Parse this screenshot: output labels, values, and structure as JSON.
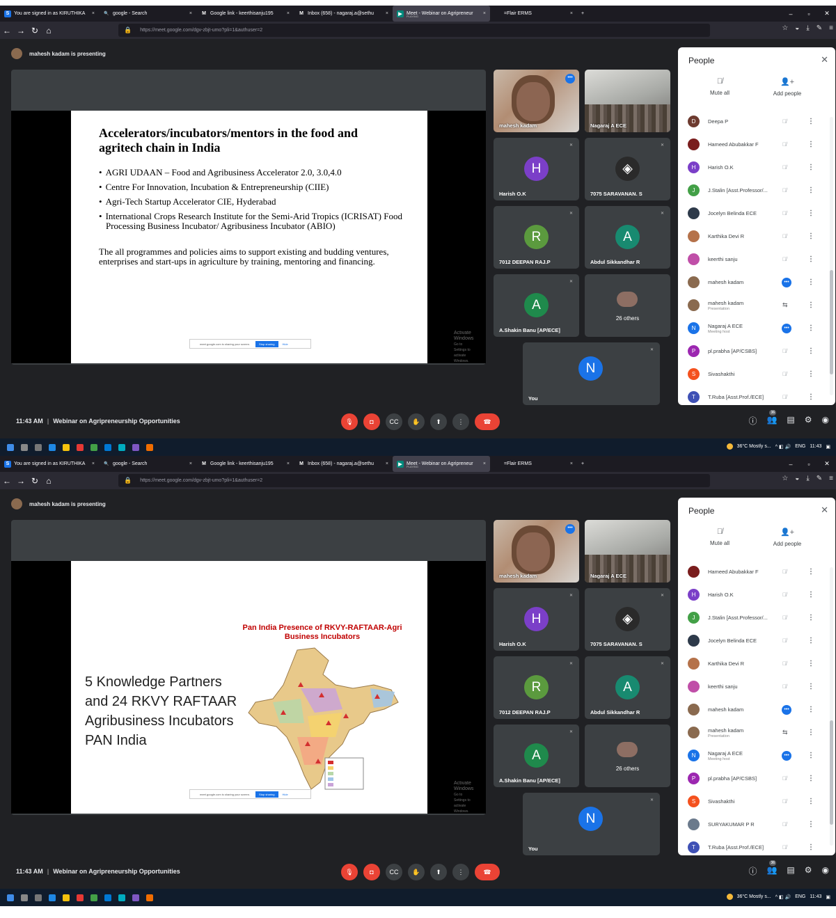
{
  "screens": [
    {
      "tabs": [
        {
          "label": "You are signed in as KIRUTHIKA",
          "icon": "S",
          "icon_color": "#1a73e8",
          "width": 142,
          "close": "×"
        },
        {
          "label": "google - Search",
          "icon": "search-icon",
          "icon_color": "#1c1b22",
          "width": 140,
          "close": "×"
        },
        {
          "label": "Google link - keerthisanju195",
          "icon": "M",
          "icon_color": "#1c1b22",
          "width": 140,
          "close": "×"
        },
        {
          "label": "Inbox (658) - nagaraj.a@sethu",
          "icon": "M",
          "icon_color": "#1c1b22",
          "width": 142,
          "close": "×"
        },
        {
          "label": "Meet - Webinar on Agripreneur",
          "sub": "PLAYING",
          "icon": "meet-icon",
          "icon_color": "#00897b",
          "width": 140,
          "close": "×",
          "active": true
        },
        {
          "label": "=Flair ERMS",
          "icon": "",
          "icon_color": "#1c1b22",
          "width": 125,
          "close": "×"
        }
      ],
      "new_tab": "+",
      "url": "https://meet.google.com/dgv-zbjt-umo?pli=1&authuser=2",
      "presenting": "mahesh kadam is presenting",
      "slide": {
        "type": "text",
        "title": "Accelerators/incubators/mentors in the food and agritech chain in India",
        "bullets": [
          "AGRI UDAAN – Food and Agribusiness Accelerator 2.0, 3.0,4.0",
          "Centre For Innovation, Incubation & Entrepreneurship (CIIE)",
          "Agri-Tech Startup Accelerator CIE, Hyderabad",
          "International Crops Research Institute for the Semi-Arid Tropics (ICRISAT) Food Processing Business Incubator/ Agribusiness Incubator (ABIO)"
        ],
        "paragraph": "The all programmes and policies aims to support existing and budding ventures, enterprises and start-ups in agriculture by training, mentoring and financing."
      },
      "share_bar": {
        "text": "meet.google.com is sharing your screen.",
        "stop": "Stop sharing",
        "hide": "Hide"
      },
      "watermark": {
        "line1": "Activate Windows",
        "line2": "Go to Settings to activate Windows."
      },
      "tiles": [
        {
          "name": "mahesh kadam",
          "kind": "cam1"
        },
        {
          "name": "Nagaraj A ECE",
          "kind": "cam2"
        },
        {
          "name": "Harish O.K",
          "letter": "H",
          "color": "#7b3fc8"
        },
        {
          "name": "7075 SARAVANAN. S",
          "letter": "",
          "color": "#3c4043",
          "photo": true
        },
        {
          "name": "7012 DEEPAN RAJ.P",
          "letter": "R",
          "color": "#5b9a3e"
        },
        {
          "name": "Abdul Sikkandhar R",
          "letter": "A",
          "color": "#188a70"
        },
        {
          "name": "A.Shakin Banu [AP/ECE]",
          "letter": "A",
          "color": "#1f8a4c"
        },
        {
          "name": "",
          "others": "26 others"
        },
        {
          "name": "You",
          "letter": "N",
          "color": "#1a73e8"
        }
      ],
      "people": {
        "title": "People",
        "mute_all": "Mute all",
        "add_people": "Add people",
        "list": [
          {
            "name": "Deepa P",
            "letter": "D",
            "color": "#6d3a2f"
          },
          {
            "name": "Hameed Abubakkar F",
            "letter": "",
            "color": "#7a1d1d"
          },
          {
            "name": "Harish O.K",
            "letter": "H",
            "color": "#7b3fc8"
          },
          {
            "name": "J.Stalin [Asst.Professor/...",
            "letter": "J",
            "color": "#43a047"
          },
          {
            "name": "Jocelyn Belinda ECE",
            "letter": "",
            "color": "#2e3a4a"
          },
          {
            "name": "Karthika Devi R",
            "letter": "",
            "color": "#b5724a"
          },
          {
            "name": "keerthi sanju",
            "letter": "",
            "color": "#c04fa8"
          },
          {
            "name": "mahesh kadam",
            "letter": "",
            "color": "#8a6a4f",
            "speaking": true
          },
          {
            "name": "mahesh kadam",
            "sub": "Presentation",
            "letter": "",
            "color": "#8a6a4f",
            "present": true
          },
          {
            "name": "Nagaraj A ECE",
            "sub": "Meeting host",
            "letter": "N",
            "color": "#1a73e8",
            "speaking": true
          },
          {
            "name": "pl.prabha [AP/CSBS]",
            "letter": "P",
            "color": "#9c27b0"
          },
          {
            "name": "Sivashakthi",
            "letter": "S",
            "color": "#f4511e"
          },
          {
            "name": "T.Ruba [Asst.Prof./ECE]",
            "letter": "T",
            "color": "#3f51b5"
          }
        ]
      },
      "time": "11:43 AM",
      "meeting_title": "Webinar on Agripreneurship Opportunities",
      "participant_count": "36",
      "tray": {
        "weather": "36°C Mostly s...",
        "lang": "ENG",
        "clock": "11:43"
      }
    },
    {
      "tabs": [
        {
          "label": "You are signed in as KIRUTHIKA",
          "icon": "S",
          "icon_color": "#1a73e8",
          "width": 142,
          "close": "×"
        },
        {
          "label": "google - Search",
          "icon": "search-icon",
          "icon_color": "#1c1b22",
          "width": 140,
          "close": "×"
        },
        {
          "label": "Google link - keerthisanju195",
          "icon": "M",
          "icon_color": "#1c1b22",
          "width": 140,
          "close": "×"
        },
        {
          "label": "Inbox (658) - nagaraj.a@sethu",
          "icon": "M",
          "icon_color": "#1c1b22",
          "width": 142,
          "close": "×"
        },
        {
          "label": "Meet - Webinar on Agripreneur",
          "sub": "PLAYING",
          "icon": "meet-icon",
          "icon_color": "#00897b",
          "width": 140,
          "close": "×",
          "active": true
        },
        {
          "label": "=Flair ERMS",
          "icon": "",
          "icon_color": "#1c1b22",
          "width": 125,
          "close": "×"
        }
      ],
      "new_tab": "+",
      "url": "https://meet.google.com/dgv-zbjt-umo?pli=1&authuser=2",
      "presenting": "mahesh kadam is presenting",
      "slide": {
        "type": "map",
        "big_text": "5 Knowledge Partners and 24 RKVY RAFTAAR Agribusiness Incubators PAN India",
        "map_title": "Pan India Presence of RKVY-RAFTAAR-Agri Business Incubators"
      },
      "share_bar": {
        "text": "meet.google.com is sharing your screen.",
        "stop": "Stop sharing",
        "hide": "Hide"
      },
      "watermark": {
        "line1": "Activate Windows",
        "line2": "Go to Settings to activate Windows."
      },
      "tiles": [
        {
          "name": "mahesh kadam",
          "kind": "cam1"
        },
        {
          "name": "Nagaraj A ECE",
          "kind": "cam2"
        },
        {
          "name": "Harish O.K",
          "letter": "H",
          "color": "#7b3fc8"
        },
        {
          "name": "7075 SARAVANAN. S",
          "letter": "",
          "color": "#3c4043",
          "photo": true
        },
        {
          "name": "7012 DEEPAN RAJ.P",
          "letter": "R",
          "color": "#5b9a3e"
        },
        {
          "name": "Abdul Sikkandhar R",
          "letter": "A",
          "color": "#188a70"
        },
        {
          "name": "A.Shakin Banu [AP/ECE]",
          "letter": "A",
          "color": "#1f8a4c"
        },
        {
          "name": "",
          "others": "26 others"
        },
        {
          "name": "You",
          "letter": "N",
          "color": "#1a73e8"
        }
      ],
      "people": {
        "title": "People",
        "mute_all": "Mute all",
        "add_people": "Add people",
        "list": [
          {
            "name": "Hameed Abubakkar F",
            "letter": "",
            "color": "#7a1d1d"
          },
          {
            "name": "Harish O.K",
            "letter": "H",
            "color": "#7b3fc8"
          },
          {
            "name": "J.Stalin [Asst.Professor/...",
            "letter": "J",
            "color": "#43a047"
          },
          {
            "name": "Jocelyn Belinda ECE",
            "letter": "",
            "color": "#2e3a4a"
          },
          {
            "name": "Karthika Devi R",
            "letter": "",
            "color": "#b5724a"
          },
          {
            "name": "keerthi sanju",
            "letter": "",
            "color": "#c04fa8"
          },
          {
            "name": "mahesh kadam",
            "letter": "",
            "color": "#8a6a4f",
            "speaking": true
          },
          {
            "name": "mahesh kadam",
            "sub": "Presentation",
            "letter": "",
            "color": "#8a6a4f",
            "present": true
          },
          {
            "name": "Nagaraj A ECE",
            "sub": "Meeting host",
            "letter": "N",
            "color": "#1a73e8",
            "speaking": true
          },
          {
            "name": "pl.prabha [AP/CSBS]",
            "letter": "P",
            "color": "#9c27b0"
          },
          {
            "name": "Sivashakthi",
            "letter": "S",
            "color": "#f4511e"
          },
          {
            "name": "SURYAKUMAR P R",
            "letter": "",
            "color": "#6b7a8c"
          },
          {
            "name": "T.Ruba [Asst.Prof./ECE]",
            "letter": "T",
            "color": "#3f51b5"
          }
        ]
      },
      "time": "11:43 AM",
      "meeting_title": "Webinar on Agripreneurship Opportunities",
      "participant_count": "36",
      "tray": {
        "weather": "36°C Mostly s...",
        "lang": "ENG",
        "clock": "11:43"
      }
    }
  ]
}
